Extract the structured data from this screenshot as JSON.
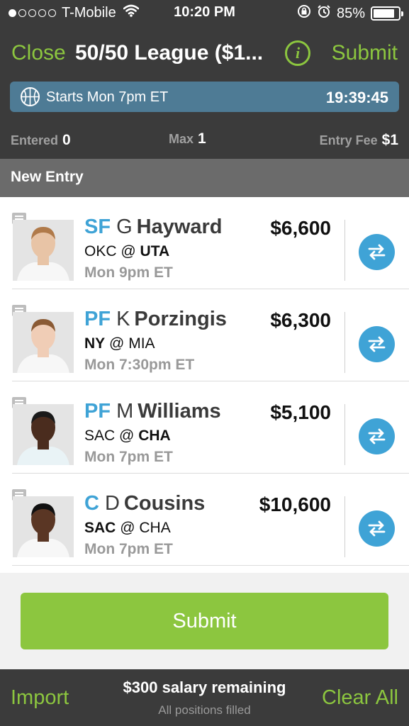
{
  "status_bar": {
    "carrier": "T-Mobile",
    "time": "10:20 PM",
    "battery": "85%",
    "battery_level": 0.85,
    "signal_bars": 1
  },
  "nav": {
    "close_label": "Close",
    "title": "50/50 League ($1...",
    "info_label": "i",
    "submit_label": "Submit"
  },
  "banner": {
    "start_text": "Starts Mon 7pm ET",
    "countdown": "19:39:45"
  },
  "contest": {
    "entered_label": "Entered",
    "entered_value": "0",
    "max_label": "Max",
    "max_value": "1",
    "fee_label": "Entry Fee",
    "fee_value": "$1"
  },
  "section": {
    "title": "New Entry"
  },
  "players": [
    {
      "pos": "SF",
      "first": "G",
      "last": "Hayward",
      "away": "OKC",
      "at": "@",
      "home": "UTA",
      "bold_team": "home",
      "time": "Mon 9pm ET",
      "salary": "$6,600",
      "skin": "#e8c4a6",
      "hair": "#b07a4a",
      "jersey": "#f7f7f7"
    },
    {
      "pos": "PF",
      "first": "K",
      "last": "Porzingis",
      "away": "NY",
      "at": "@",
      "home": "MIA",
      "bold_team": "away",
      "time": "Mon 7:30pm ET",
      "salary": "$6,300",
      "skin": "#f0cdb6",
      "hair": "#8a5a34",
      "jersey": "#f7f7f7"
    },
    {
      "pos": "PF",
      "first": "M",
      "last": "Williams",
      "away": "SAC",
      "at": "@",
      "home": "CHA",
      "bold_team": "home",
      "time": "Mon 7pm ET",
      "salary": "$5,100",
      "skin": "#4a2c1e",
      "hair": "#1a1a1a",
      "jersey": "#e9f3f6"
    },
    {
      "pos": "C",
      "first": "D",
      "last": "Cousins",
      "away": "SAC",
      "at": "@",
      "home": "CHA",
      "bold_team": "away",
      "time": "Mon 7pm ET",
      "salary": "$10,600",
      "skin": "#5a3624",
      "hair": "#111111",
      "jersey": "#f7f7f7"
    }
  ],
  "actions": {
    "submit_label": "Submit",
    "import_label": "Import",
    "salary_text": "$300 salary remaining",
    "filled_text": "All positions filled",
    "clear_label": "Clear All"
  },
  "colors": {
    "accent_green": "#8cc63f",
    "position_blue": "#3fa3d6",
    "bar_dark": "#3b3b3b",
    "banner_blue": "#4e7b95"
  }
}
